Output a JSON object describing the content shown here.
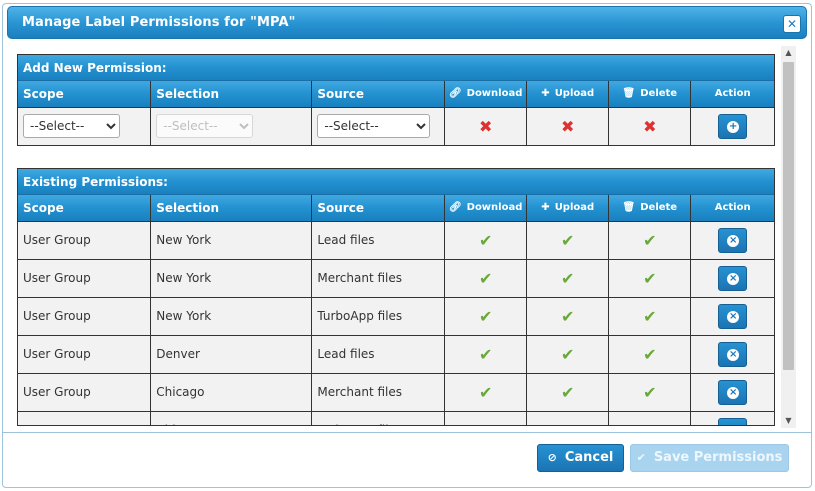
{
  "dialog": {
    "title": "Manage Label Permissions for \"MPA\"",
    "close_icon": "close-icon"
  },
  "add_section": {
    "header": "Add New Permission:",
    "columns": [
      "Scope",
      "Selection",
      "Source",
      "Download",
      "Upload",
      "Delete",
      "Action"
    ],
    "scope_select": "--Select--",
    "selection_select": "--Select--",
    "source_select": "--Select--",
    "download": "deny",
    "upload": "deny",
    "delete": "deny",
    "action_icon": "add-icon"
  },
  "existing_section": {
    "header": "Existing Permissions:",
    "columns": [
      "Scope",
      "Selection",
      "Source",
      "Download",
      "Upload",
      "Delete",
      "Action"
    ],
    "rows": [
      {
        "scope": "User Group",
        "selection": "New York",
        "source": "Lead files"
      },
      {
        "scope": "User Group",
        "selection": "New York",
        "source": "Merchant files"
      },
      {
        "scope": "User Group",
        "selection": "New York",
        "source": "TurboApp files"
      },
      {
        "scope": "User Group",
        "selection": "Denver",
        "source": "Lead files"
      },
      {
        "scope": "User Group",
        "selection": "Chicago",
        "source": "Merchant files"
      },
      {
        "scope": "User Group",
        "selection": "Chicago",
        "source": "TurboApp files"
      }
    ]
  },
  "footer": {
    "cancel_label": "Cancel",
    "save_label": "Save Permissions"
  },
  "colors": {
    "accent": "#2391d0",
    "check": "#6aa83a",
    "deny": "#e03030"
  }
}
